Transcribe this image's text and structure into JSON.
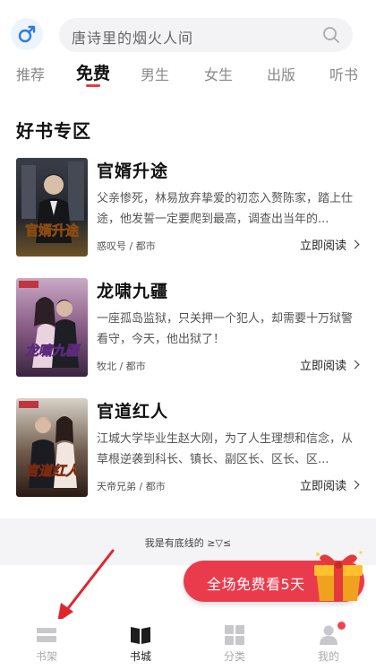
{
  "search": {
    "placeholder": "唐诗里的烟火人间",
    "icon": "search-icon"
  },
  "gender_icon": "male-symbol-icon",
  "tabs": [
    {
      "label": "推荐",
      "active": false
    },
    {
      "label": "免费",
      "active": true
    },
    {
      "label": "男生",
      "active": false
    },
    {
      "label": "女生",
      "active": false
    },
    {
      "label": "出版",
      "active": false
    },
    {
      "label": "听书",
      "active": false
    }
  ],
  "section": {
    "title": "好书专区"
  },
  "books": [
    {
      "title": "官婿升途",
      "desc": "父亲惨死，林易放弃挚爱的初恋入赘陈家，踏上仕途，他发誓一定要爬到最高，调查出当年的...",
      "meta": "惑叹号 / 都市",
      "action": "立即阅读",
      "cover_text": "官婿升途"
    },
    {
      "title": "龙啸九疆",
      "desc": "一座孤岛监狱，只关押一个犯人，却需要十万狱警看守，今天，他出狱了！",
      "meta": "牧北 / 都市",
      "action": "立即阅读",
      "cover_text": "龙啸九疆"
    },
    {
      "title": "官道红人",
      "desc": "江城大学毕业生赵大刚，为了人生理想和信念，从草根逆袭到科长、镇长、副区长、区长、区...",
      "meta": "天帝兄弟 / 都市",
      "action": "立即阅读",
      "cover_text": "官道红人"
    }
  ],
  "footer_text": "我是有底线的 ≥▽≤",
  "promo": {
    "label": "全场免费看5天"
  },
  "nav": [
    {
      "label": "书架",
      "icon": "bookshelf-icon",
      "active": false
    },
    {
      "label": "书城",
      "icon": "book-city-icon",
      "active": true
    },
    {
      "label": "分类",
      "icon": "category-icon",
      "active": false
    },
    {
      "label": "我的",
      "icon": "profile-icon",
      "active": false,
      "badge": true
    }
  ],
  "colors": {
    "accent": "#e53946",
    "promo": "#ea3b4c"
  }
}
